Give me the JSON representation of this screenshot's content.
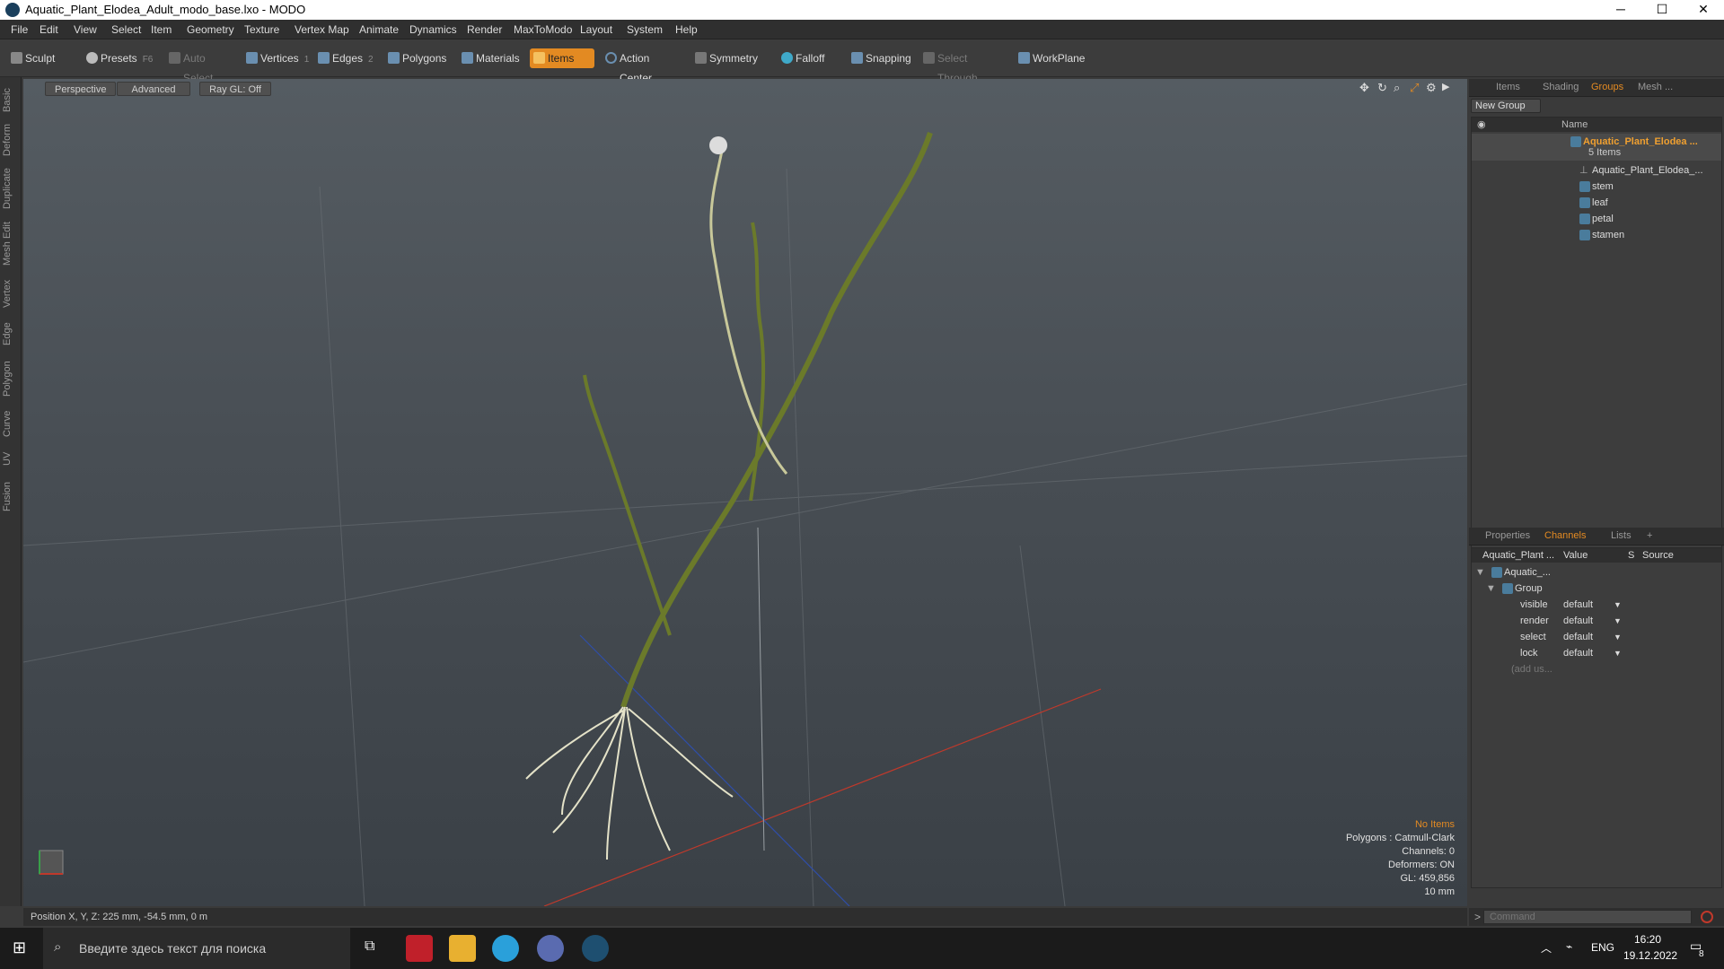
{
  "window": {
    "title": "Aquatic_Plant_Elodea_Adult_modo_base.lxo - MODO",
    "minimize": "─",
    "maximize": "☐",
    "close": "✕"
  },
  "menu": [
    "File",
    "Edit",
    "View",
    "Select",
    "Item",
    "Geometry",
    "Texture",
    "Vertex Map",
    "Animate",
    "Dynamics",
    "Render",
    "MaxToModo",
    "Layout",
    "System",
    "Help"
  ],
  "toolbar": {
    "sculpt": "Sculpt",
    "presets": "Presets",
    "presets_key": "F6",
    "auto_select": "Auto Select",
    "vertices": "Vertices",
    "vertices_key": "1",
    "edges": "Edges",
    "edges_key": "2",
    "polygons": "Polygons",
    "materials": "Materials",
    "items": "Items",
    "action_center": "Action Center",
    "symmetry": "Symmetry",
    "falloff": "Falloff",
    "snapping": "Snapping",
    "select_through": "Select Through",
    "workplane": "WorkPlane"
  },
  "left_tabs": [
    "Basic",
    "Deform",
    "Duplicate",
    "Mesh Edit",
    "Vertex",
    "Edge",
    "Polygon",
    "Curve",
    "UV",
    "Fusion"
  ],
  "viewport": {
    "view": "Perspective",
    "shading": "Advanced",
    "raygl": "Ray GL: Off",
    "info": {
      "items": "No Items",
      "polygons": "Polygons : Catmull-Clark",
      "channels": "Channels: 0",
      "deformers": "Deformers: ON",
      "gl": "GL: 459,856",
      "scale": "10 mm"
    }
  },
  "status": {
    "position": "Position X, Y, Z:  225 mm, -54.5 mm, 0 m"
  },
  "items_panel": {
    "tabs": [
      "Items",
      "Shading",
      "Groups",
      "Mesh ..."
    ],
    "active_tab": "Groups",
    "new_group": "New Group",
    "col_name": "Name",
    "group_name": "Aquatic_Plant_Elodea ...",
    "group_count": "5 Items",
    "children": [
      "Aquatic_Plant_Elodea_...",
      "stem",
      "leaf",
      "petal",
      "stamen"
    ]
  },
  "channels_panel": {
    "tabs": [
      "Properties",
      "Channels",
      "Lists",
      "+"
    ],
    "active_tab": "Channels",
    "columns": [
      "Aquatic_Plant ...",
      "Value",
      "S",
      "Source"
    ],
    "root": "Aquatic_...",
    "group": "Group",
    "rows": [
      {
        "name": "visible",
        "value": "default"
      },
      {
        "name": "render",
        "value": "default"
      },
      {
        "name": "select",
        "value": "default"
      },
      {
        "name": "lock",
        "value": "default"
      }
    ],
    "add_user": "(add us..."
  },
  "command": {
    "placeholder": "Command"
  },
  "taskbar": {
    "search_placeholder": "Введите здесь текст для поиска",
    "lang": "ENG",
    "time": "16:20",
    "date": "19.12.2022",
    "notif": "8"
  },
  "colors": {
    "accent": "#e38a22",
    "panel": "#3a3a3a",
    "viewport_top": "#555c62"
  }
}
